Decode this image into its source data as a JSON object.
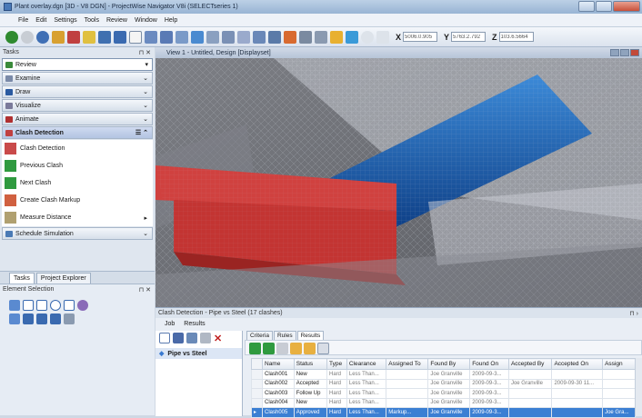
{
  "window": {
    "title": "Plant overlay.dgn [3D - V8 DGN] - ProjectWise Navigator V8i (SELECTseries 1)"
  },
  "menu": [
    "File",
    "Edit",
    "Settings",
    "Tools",
    "Review",
    "Window",
    "Help"
  ],
  "coords": {
    "x_label": "X",
    "x_value": "5006.0.905",
    "y_label": "Y",
    "y_value": "5763.2.792",
    "z_label": "Z",
    "z_value": "103.6.5664"
  },
  "tasks_pane": {
    "header": "Tasks",
    "items": [
      {
        "label": "Review",
        "icon": "review-icon",
        "color": "#3a8a3a"
      },
      {
        "label": "Examine",
        "icon": "examine-icon",
        "color": "#7a8aa8"
      },
      {
        "label": "Draw",
        "icon": "draw-icon",
        "color": "#2a5aa0"
      },
      {
        "label": "Visualize",
        "icon": "visualize-icon",
        "color": "#7a7a9a"
      },
      {
        "label": "Animate",
        "icon": "animate-icon",
        "color": "#b03030"
      }
    ],
    "active_group": "Clash Detection",
    "clash_items": [
      {
        "label": "Clash Detection",
        "icon": "clash-detection-icon"
      },
      {
        "label": "Previous Clash",
        "icon": "previous-clash-icon"
      },
      {
        "label": "Next Clash",
        "icon": "next-clash-icon"
      },
      {
        "label": "Create Clash Markup",
        "icon": "clash-markup-icon"
      },
      {
        "label": "Measure Distance",
        "icon": "measure-distance-icon"
      }
    ],
    "schedule": "Schedule Simulation"
  },
  "left_tabs": [
    "Tasks",
    "Project Explorer"
  ],
  "element_selection": {
    "header": "Element Selection"
  },
  "viewport": {
    "title": "View 1 - Untitled, Design [Displayset]"
  },
  "clash_panel": {
    "title": "Clash Detection - Pipe vs Steel (17 clashes)",
    "menu": [
      "Job",
      "Results"
    ],
    "tree_node": "Pipe vs Steel",
    "subtabs": [
      "Criteria",
      "Rules",
      "Results"
    ],
    "columns": [
      "Name",
      "Status",
      "Type",
      "Clearance",
      "Assigned To",
      "Found By",
      "Found On",
      "Accepted By",
      "Accepted On",
      "Assign"
    ],
    "rows": [
      [
        "Clash001",
        "New",
        "Hard",
        "Less Than...",
        "",
        "Joe Granville",
        "2009-09-3...",
        "",
        "",
        ""
      ],
      [
        "Clash002",
        "Accepted",
        "Hard",
        "Less Than...",
        "",
        "Joe Granville",
        "2009-09-3...",
        "Joe Granville",
        "2009-09-30 11...",
        ""
      ],
      [
        "Clash003",
        "Follow Up",
        "Hard",
        "Less Than...",
        "",
        "Joe Granville",
        "2009-09-3...",
        "",
        "",
        ""
      ],
      [
        "Clash004",
        "New",
        "Hard",
        "Less Than...",
        "",
        "Joe Granville",
        "2009-09-3...",
        "",
        "",
        ""
      ],
      [
        "Clash005",
        "Approved",
        "Hard",
        "Less Than...",
        "Markup...",
        "Joe Granville",
        "2009-09-3...",
        "",
        "",
        "Joe Gra..."
      ]
    ],
    "selected_row": 4
  }
}
